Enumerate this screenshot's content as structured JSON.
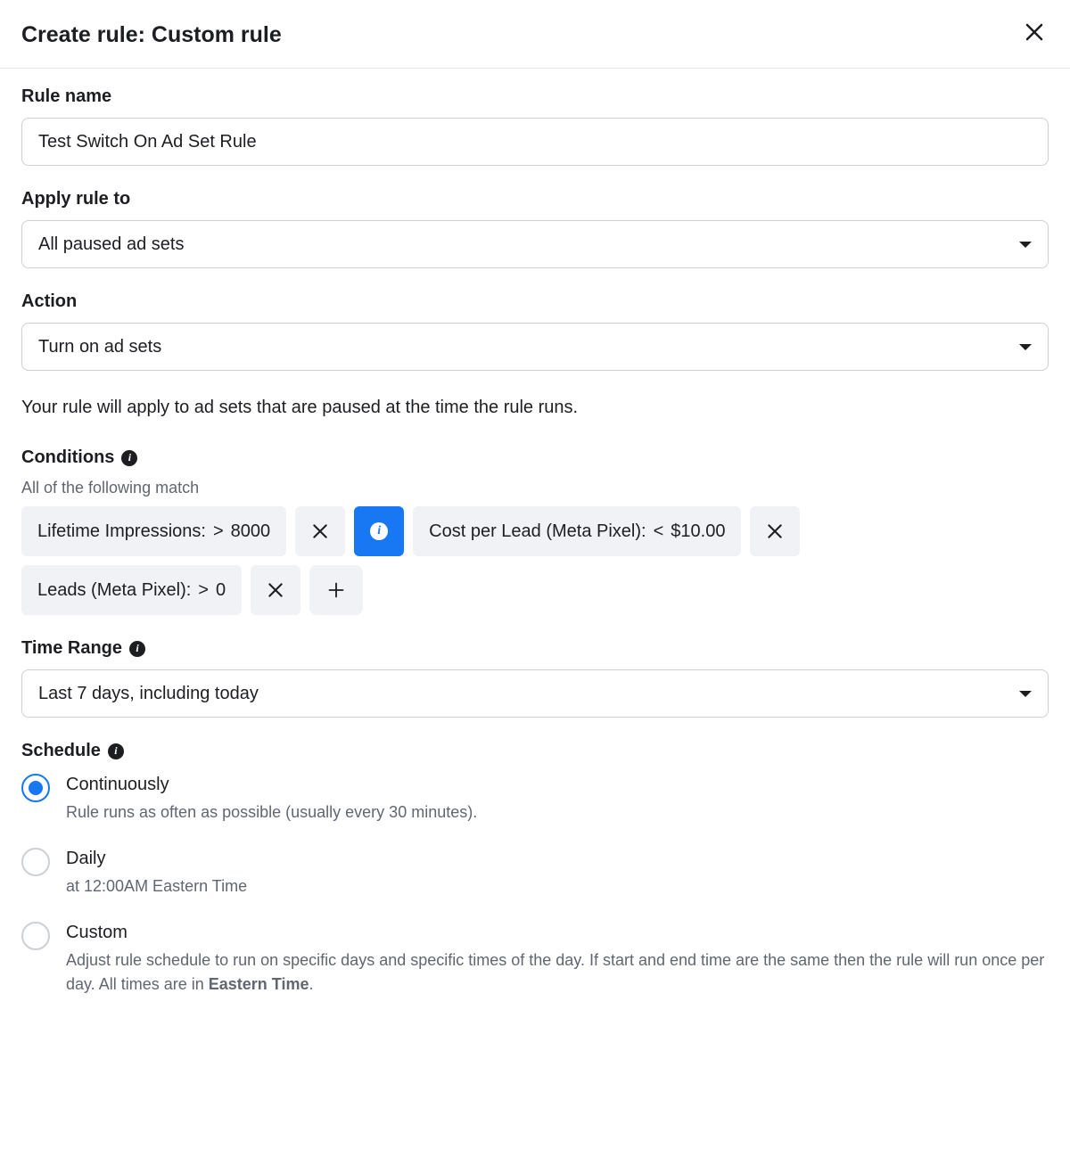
{
  "header": {
    "title": "Create rule: Custom rule"
  },
  "ruleName": {
    "label": "Rule name",
    "value": "Test Switch On Ad Set Rule"
  },
  "applyTo": {
    "label": "Apply rule to",
    "value": "All paused ad sets"
  },
  "action": {
    "label": "Action",
    "value": "Turn on ad sets",
    "description": "Your rule will apply to ad sets that are paused at the time the rule runs."
  },
  "conditions": {
    "label": "Conditions",
    "subtext": "All of the following match",
    "items": [
      {
        "metric": "Lifetime Impressions:",
        "op": ">",
        "val": "8000"
      },
      {
        "metric": "Cost per Lead (Meta Pixel):",
        "op": "<",
        "val": "$10.00"
      },
      {
        "metric": "Leads (Meta Pixel):",
        "op": ">",
        "val": "0"
      }
    ]
  },
  "timeRange": {
    "label": "Time Range",
    "value": "Last 7 days, including today"
  },
  "schedule": {
    "label": "Schedule",
    "options": [
      {
        "title": "Continuously",
        "desc": "Rule runs as often as possible (usually every 30 minutes).",
        "selected": true
      },
      {
        "title": "Daily",
        "desc": "at 12:00AM Eastern Time",
        "selected": false
      },
      {
        "title": "Custom",
        "descPrefix": "Adjust rule schedule to run on specific days and specific times of the day. If start and end time are the same then the rule will run once per day. All times are in ",
        "descBold": "Eastern Time",
        "descSuffix": ".",
        "selected": false
      }
    ]
  }
}
